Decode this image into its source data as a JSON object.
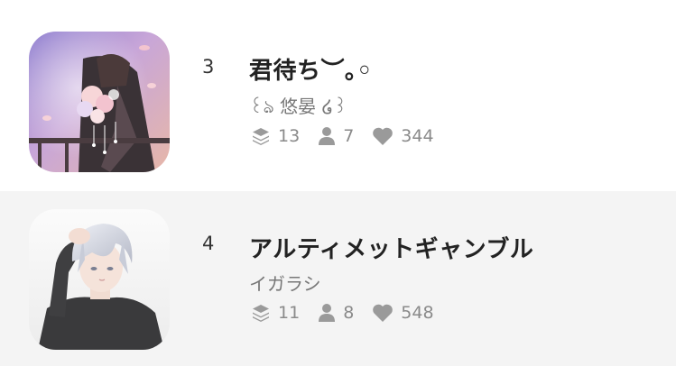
{
  "stories": [
    {
      "rank": "3",
      "title": "君待ち︶｡◦",
      "author": "꒰ঌ 悠晏 ໒꒱",
      "stats": {
        "chapters": "13",
        "readers": "7",
        "likes": "344"
      },
      "icons": {
        "chapters": "stack-icon",
        "readers": "person-icon",
        "likes": "heart-icon"
      },
      "cover": "crescent-moon-flowers-illustration"
    },
    {
      "rank": "4",
      "title": "アルティメットギャンブル",
      "author": "イガラシ",
      "stats": {
        "chapters": "11",
        "readers": "8",
        "likes": "548"
      },
      "icons": {
        "chapters": "stack-icon",
        "readers": "person-icon",
        "likes": "heart-icon"
      },
      "cover": "silver-haired-character-illustration"
    }
  ],
  "colors": {
    "row_alt_background": "#f4f4f4",
    "stat_gray": "#9a9a9a",
    "title_text": "#222222",
    "author_text": "#777777"
  }
}
